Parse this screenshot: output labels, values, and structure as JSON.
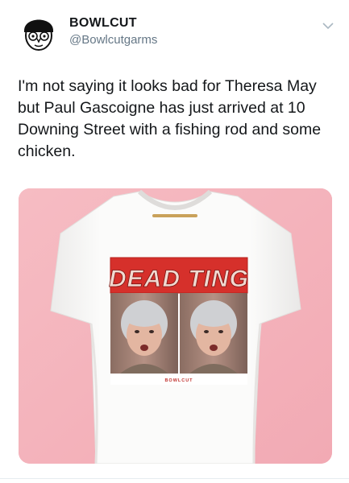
{
  "tweet": {
    "display_name": "BOWLCUT",
    "handle": "@Bowlcutgarms",
    "text": "I'm not saying it looks bad for Theresa May but Paul Gascoigne has just arrived at 10 Downing Street with a fishing rod and some chicken.",
    "menu_icon": "chevron-down-icon"
  },
  "media": {
    "shirt_headline": "DEAD TING",
    "shirt_brand": "BOWLCUT",
    "colors": {
      "background": "#f4b6be",
      "shirt": "#fbfbfa",
      "banner_red": "#d6302b",
      "banner_text": "#f1d9d0"
    }
  }
}
